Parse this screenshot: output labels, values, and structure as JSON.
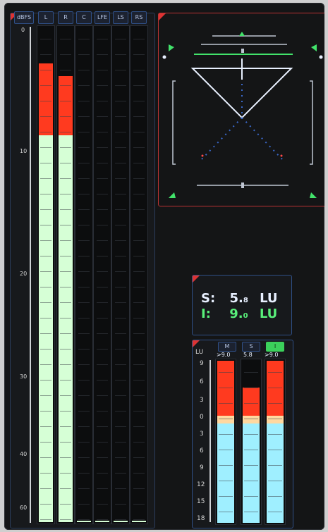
{
  "meters": {
    "unit_label": "dBFS",
    "channels": [
      {
        "label": "L",
        "level_pct": 89,
        "peak_red_top_pct": 89
      },
      {
        "label": "R",
        "level_pct": 86,
        "peak_red_top_pct": 86
      },
      {
        "label": "C",
        "level_pct": 0
      },
      {
        "label": "LFE",
        "level_pct": 0
      },
      {
        "label": "LS",
        "level_pct": 0
      },
      {
        "label": "RS",
        "level_pct": 0
      }
    ],
    "scale": [
      "0",
      "10",
      "20",
      "30",
      "40",
      "60"
    ]
  },
  "loudness_readout": {
    "short_term_label": "S:",
    "short_term_value": "5.",
    "short_term_decimal": "8",
    "short_term_unit": "LU",
    "integrated_label": "I:",
    "integrated_value": "9.",
    "integrated_decimal": "0",
    "integrated_unit": "LU"
  },
  "lu_meter": {
    "unit_label": "LU",
    "columns": [
      {
        "label": "M",
        "value": ">9.0"
      },
      {
        "label": "S",
        "value": "5.8"
      },
      {
        "label": "I",
        "value": ">9.0"
      }
    ],
    "scale": [
      "9",
      "6",
      "3",
      "0",
      "3",
      "6",
      "9",
      "12",
      "15",
      "18"
    ]
  },
  "colors": {
    "peak": "#ff3a1f",
    "level_green": "#d6ffd6",
    "lu_cyan": "#9fefff",
    "lu_amber": "#ffd8a0",
    "vecto_line": "#ffffff",
    "vecto_green": "#42e36b",
    "readout_white": "#e8f0ff",
    "readout_green": "#59ef7a"
  }
}
